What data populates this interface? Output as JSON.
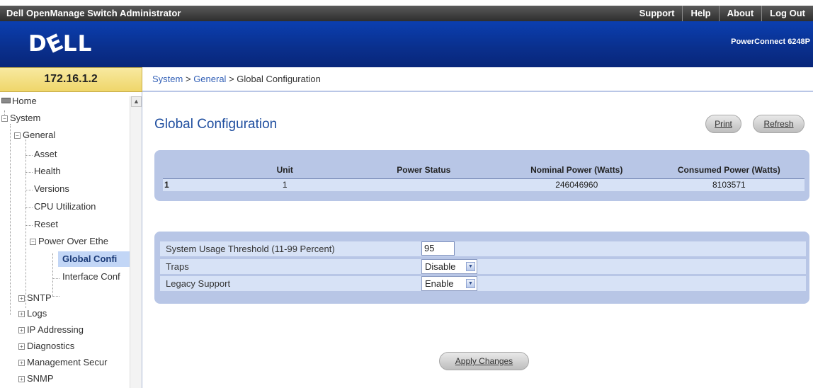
{
  "app": {
    "title": "Dell OpenManage Switch Administrator",
    "model": "PowerConnect 6248P",
    "logo_text": "DELL"
  },
  "topnav": {
    "items": [
      "Support",
      "Help",
      "About",
      "Log Out"
    ]
  },
  "ip_address": "172.16.1.2",
  "breadcrumb": {
    "items": [
      "System",
      "General",
      "Global Configuration"
    ],
    "separator": ">"
  },
  "sidebar": {
    "items": [
      {
        "label": "Home",
        "icon": "home-icon"
      },
      {
        "label": "System",
        "toggle": "−"
      },
      {
        "label": "General",
        "toggle": "−"
      },
      {
        "label": "Asset"
      },
      {
        "label": "Health"
      },
      {
        "label": "Versions"
      },
      {
        "label": "CPU Utilization"
      },
      {
        "label": "Reset"
      },
      {
        "label": "Power Over Ethe",
        "toggle": "−"
      },
      {
        "label": "Global Confi",
        "selected": true
      },
      {
        "label": "Interface Conf"
      },
      {
        "label": "SNTP",
        "toggle": "+"
      },
      {
        "label": "Logs",
        "toggle": "+"
      },
      {
        "label": "IP Addressing",
        "toggle": "+"
      },
      {
        "label": "Diagnostics",
        "toggle": "+"
      },
      {
        "label": "Management Secur",
        "toggle": "+"
      },
      {
        "label": "SNMP",
        "toggle": "+"
      }
    ]
  },
  "main": {
    "title": "Global Configuration",
    "print_label": "Print",
    "refresh_label": "Refresh",
    "apply_label": "Apply Changes",
    "power_table": {
      "headers": [
        "",
        "Unit",
        "Power Status",
        "Nominal Power (Watts)",
        "Consumed Power (Watts)"
      ],
      "rows": [
        [
          "1",
          "1",
          "",
          "246046960",
          "8103571"
        ]
      ]
    },
    "settings": {
      "threshold_label": "System Usage Threshold (11-99 Percent)",
      "threshold_value": "95",
      "traps_label": "Traps",
      "traps_value": "Disable",
      "legacy_label": "Legacy Support",
      "legacy_value": "Enable"
    }
  },
  "colors": {
    "banner": "#0a2f8c",
    "title_blue": "#1f4e9f",
    "panel": "#b8c6e6",
    "row": "#d7e2f6",
    "ip_box": "#f2dc7a"
  }
}
